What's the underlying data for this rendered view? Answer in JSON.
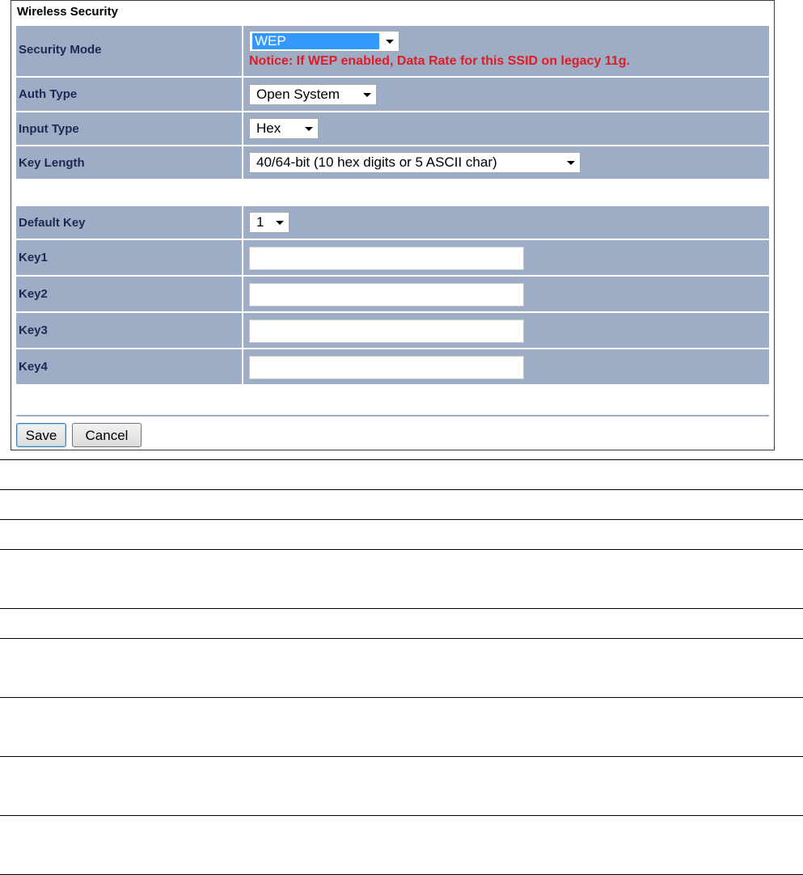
{
  "panel": {
    "title": "Wireless Security"
  },
  "fields": {
    "security_mode": {
      "label": "Security Mode",
      "value": "WEP",
      "notice": "Notice: If WEP enabled, Data Rate for this SSID on legacy 11g."
    },
    "auth_type": {
      "label": "Auth Type",
      "value": "Open System"
    },
    "input_type": {
      "label": "Input Type",
      "value": "Hex"
    },
    "key_length": {
      "label": "Key Length",
      "value": "40/64-bit (10 hex digits or 5 ASCII char)"
    },
    "default_key": {
      "label": "Default Key",
      "value": "1"
    },
    "key1": {
      "label": "Key1",
      "value": ""
    },
    "key2": {
      "label": "Key2",
      "value": ""
    },
    "key3": {
      "label": "Key3",
      "value": ""
    },
    "key4": {
      "label": "Key4",
      "value": ""
    }
  },
  "buttons": {
    "save": "Save",
    "cancel": "Cancel"
  },
  "colors": {
    "row_background": "#9dadc5",
    "label_text": "#1b2a52",
    "notice_text": "#e01b24",
    "selection_highlight": "#3399ff"
  }
}
